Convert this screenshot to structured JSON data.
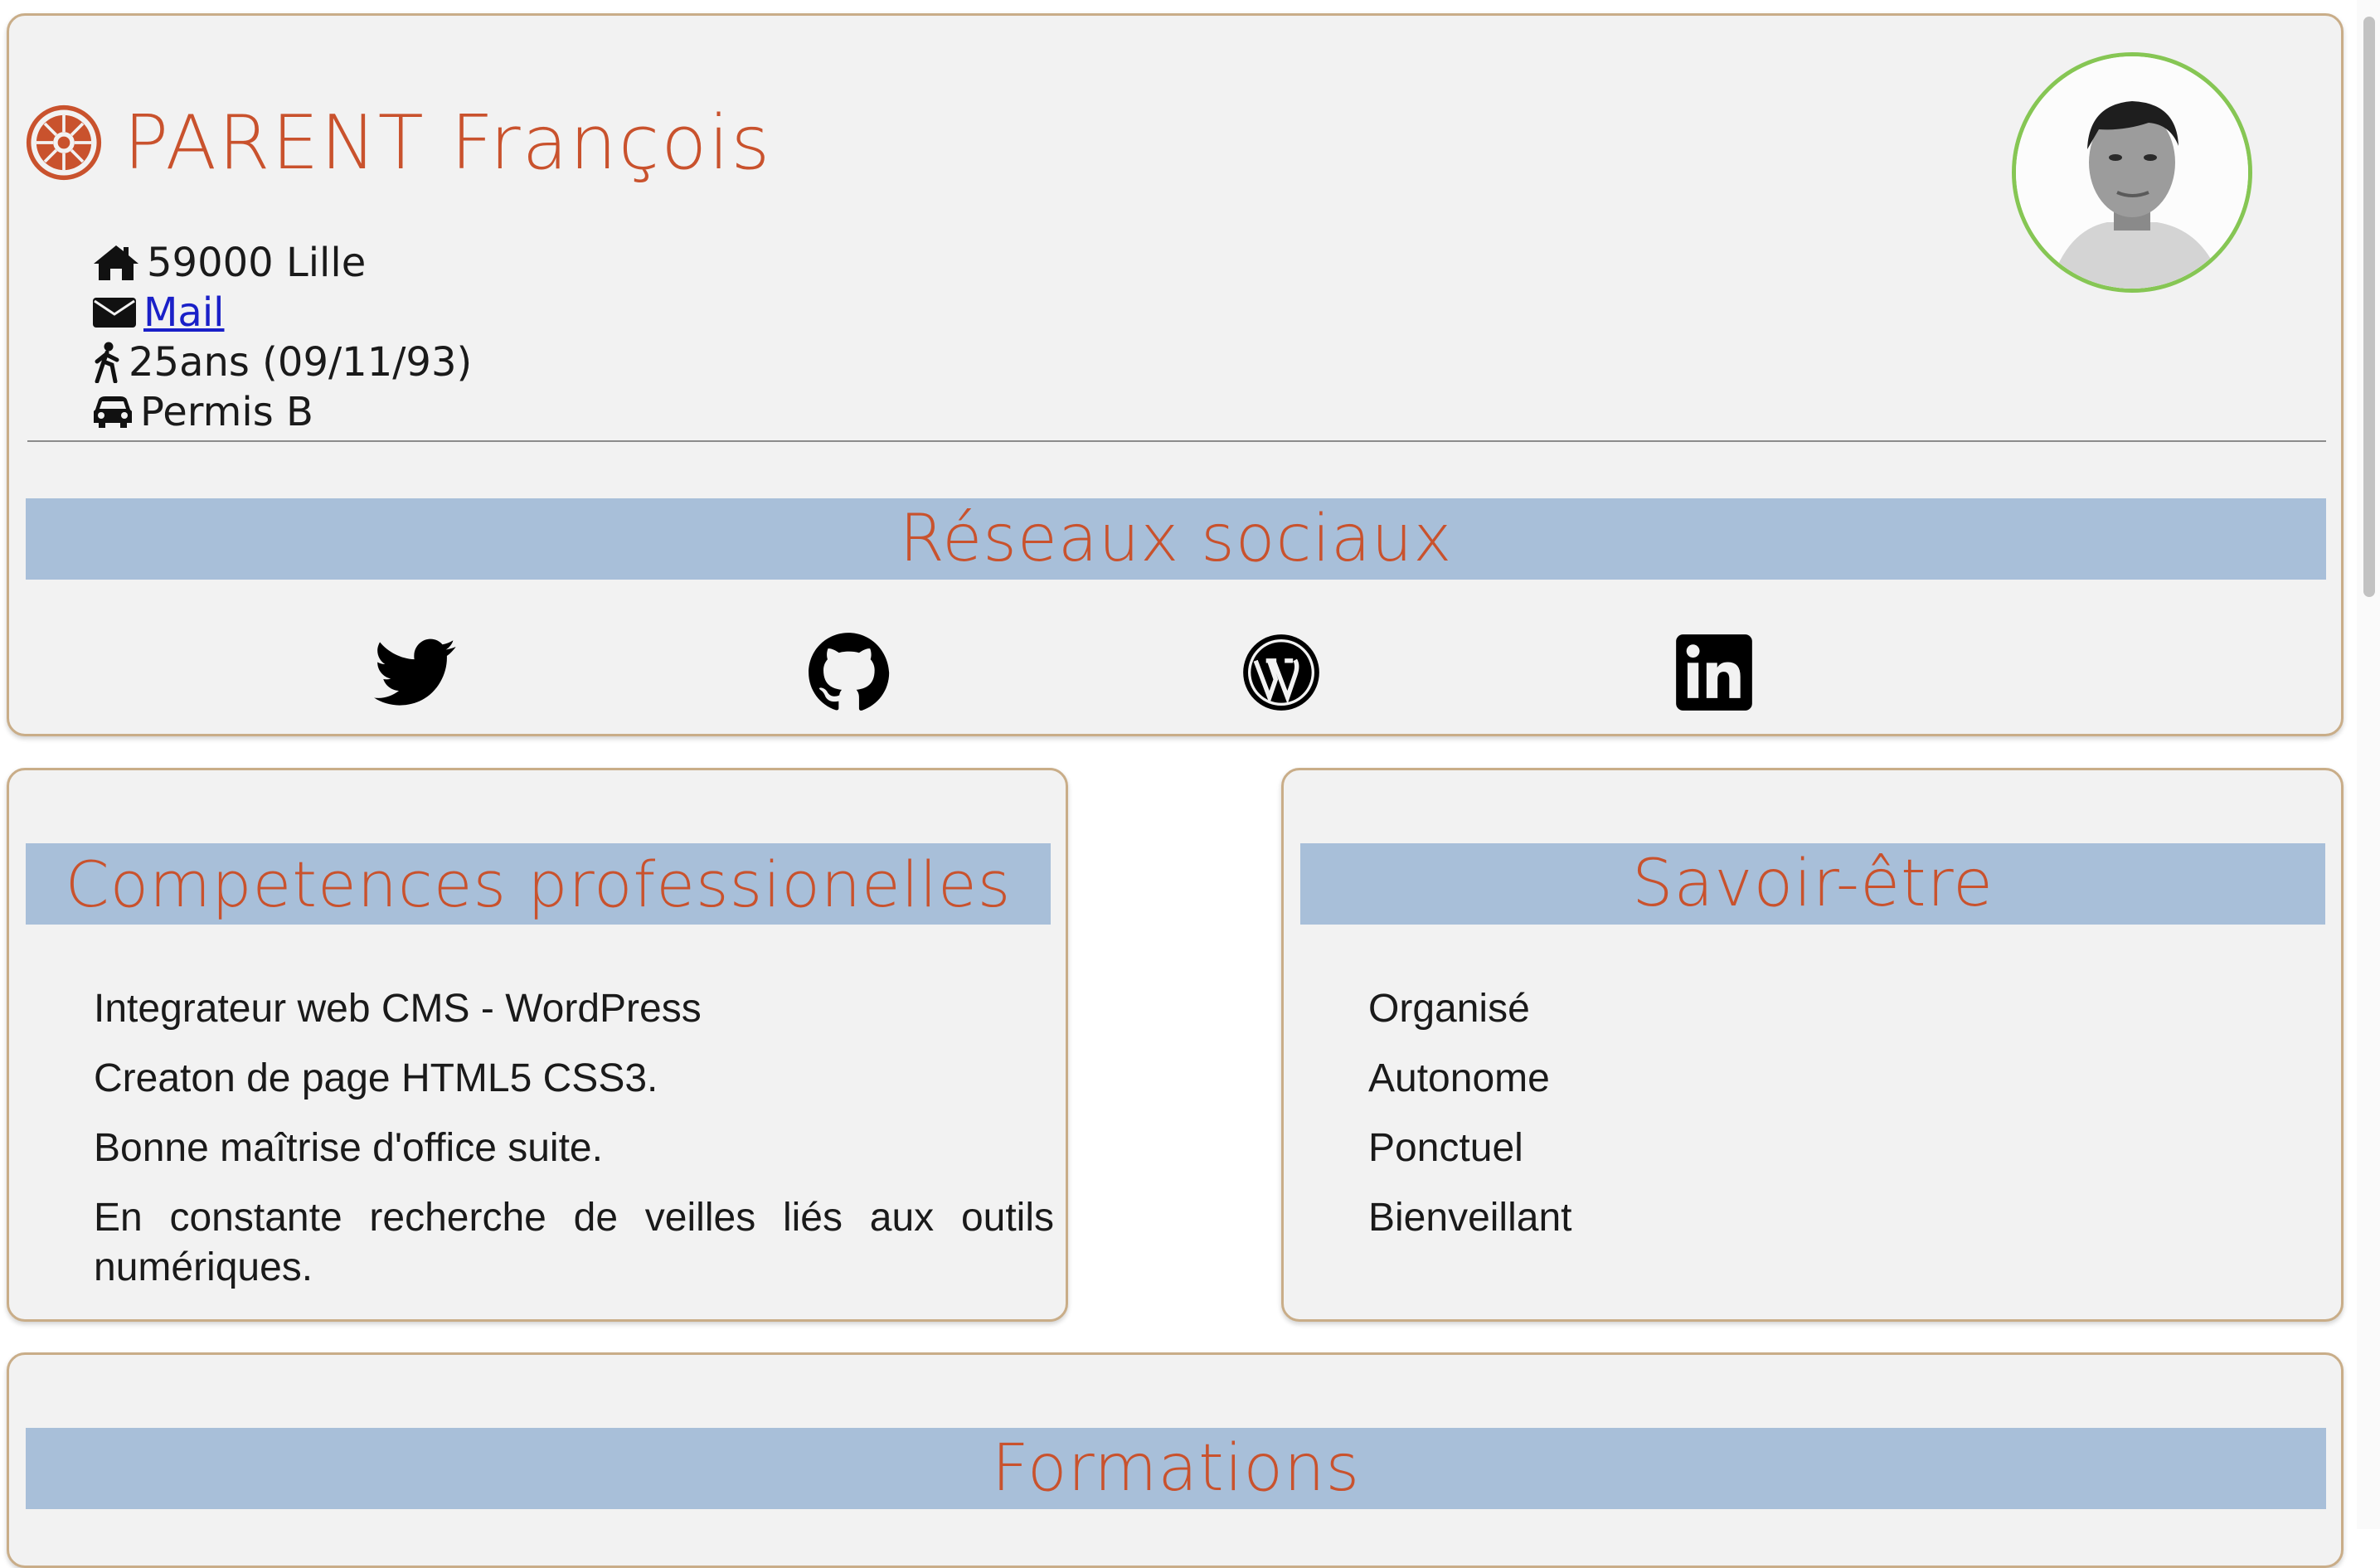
{
  "header": {
    "name": "PARENT François",
    "logo_icon": "galactic-empire-icon",
    "info": {
      "address": "59000 Lille",
      "mail": "Mail",
      "age": "25ans (09/11/93)",
      "license": "Permis B"
    }
  },
  "social": {
    "title": "Réseaux sociaux",
    "icons": [
      "twitter-icon",
      "github-icon",
      "wordpress-icon",
      "linkedin-icon"
    ]
  },
  "skills": {
    "title": "Competences professionelles",
    "items": [
      "Integrateur web CMS - WordPress",
      "Creaton de page HTML5 CSS3.",
      "Bonne maîtrise d'office suite.",
      "En constante recherche de veilles liés aux outils numériques."
    ]
  },
  "soft_skills": {
    "title": "Savoir-être",
    "items": [
      "Organisé",
      "Autonome",
      "Ponctuel",
      "Bienveillant"
    ]
  },
  "formations": {
    "title": "Formations"
  },
  "colors": {
    "accent": "#c9522d",
    "section_bar": "#a8bfd9",
    "card_bg": "#f2f2f2",
    "card_border": "#c9ad88",
    "avatar_ring": "#86c654",
    "link": "#1a20c8"
  }
}
